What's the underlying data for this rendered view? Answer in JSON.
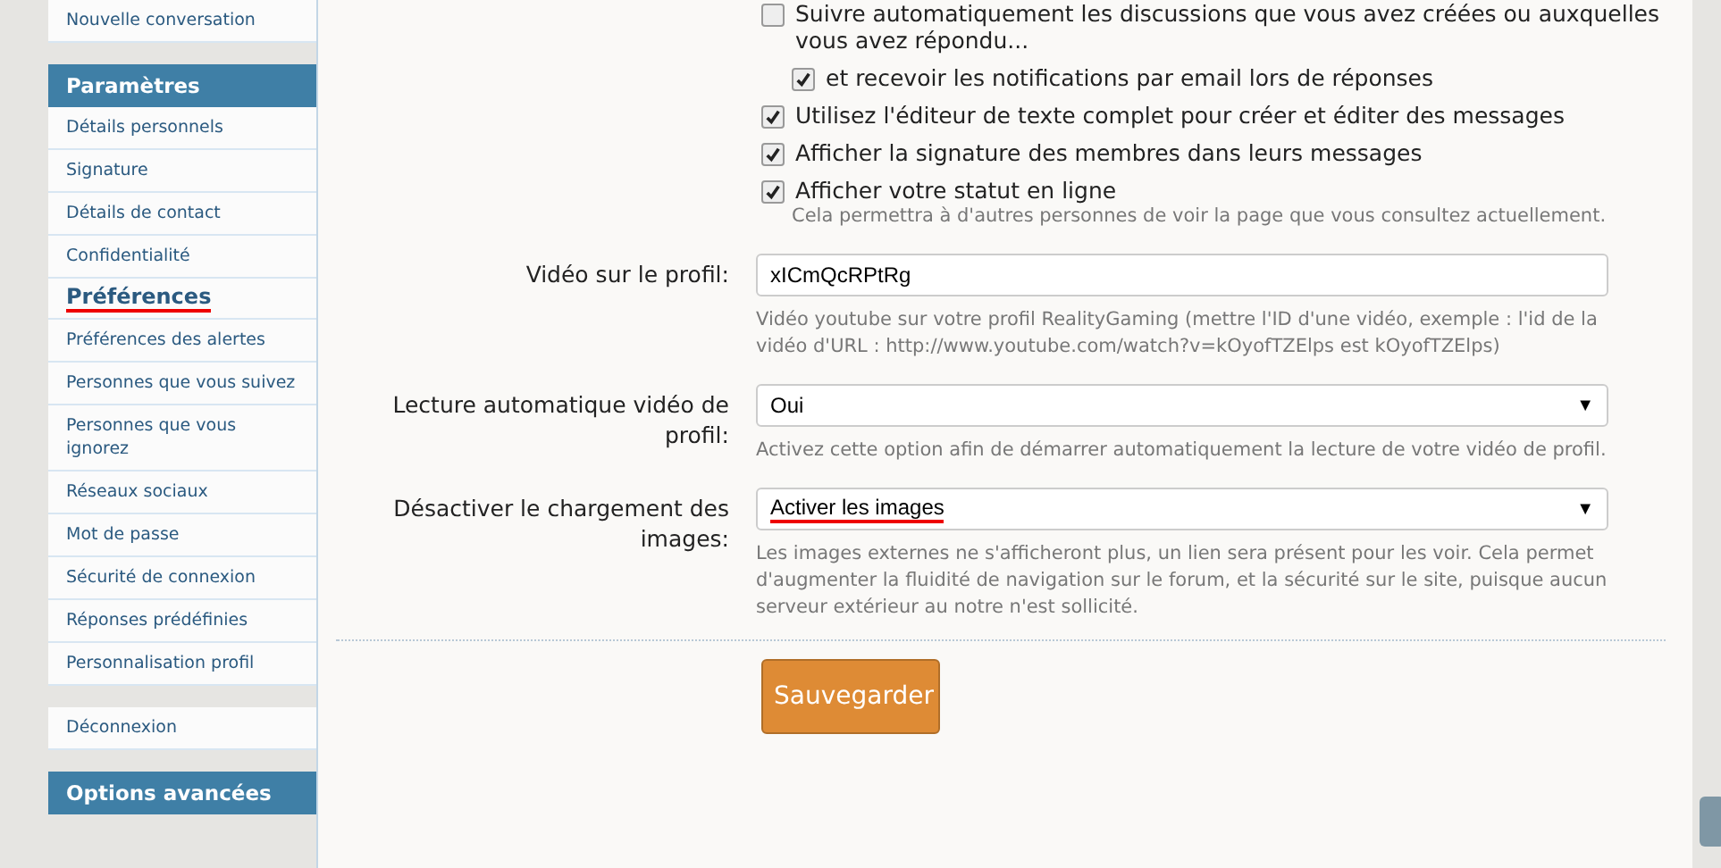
{
  "sidebar": {
    "blocks": [
      {
        "items": [
          {
            "label": "Nouvelle conversation",
            "selected": false,
            "underlined": false
          }
        ]
      },
      {
        "heading": "Paramètres",
        "items": [
          {
            "label": "Détails personnels",
            "selected": false,
            "underlined": false
          },
          {
            "label": "Signature",
            "selected": false,
            "underlined": false
          },
          {
            "label": "Détails de contact",
            "selected": false,
            "underlined": false
          },
          {
            "label": "Confidentialité",
            "selected": false,
            "underlined": false
          },
          {
            "label": "Préférences",
            "selected": true,
            "underlined": true
          },
          {
            "label": "Préférences des alertes",
            "selected": false,
            "underlined": false
          },
          {
            "label": "Personnes que vous suivez",
            "selected": false,
            "underlined": false
          },
          {
            "label": "Personnes que vous ignorez",
            "selected": false,
            "underlined": false
          },
          {
            "label": "Réseaux sociaux",
            "selected": false,
            "underlined": false
          },
          {
            "label": "Mot de passe",
            "selected": false,
            "underlined": false
          },
          {
            "label": "Sécurité de connexion",
            "selected": false,
            "underlined": false
          },
          {
            "label": "Réponses prédéfinies",
            "selected": false,
            "underlined": false
          },
          {
            "label": "Personnalisation profil",
            "selected": false,
            "underlined": false
          }
        ]
      },
      {
        "items": [
          {
            "label": "Déconnexion",
            "selected": false,
            "underlined": false
          }
        ]
      },
      {
        "heading": "Options avancées"
      }
    ]
  },
  "checkboxes": [
    {
      "label": "Suivre automatiquement les discussions que vous avez créées ou auxquelles vous avez répondu...",
      "checked": false,
      "children": [
        {
          "label": "et recevoir les notifications par email lors de réponses",
          "checked": true
        }
      ]
    },
    {
      "label": "Utilisez l'éditeur de texte complet pour créer et éditer des messages",
      "checked": true
    },
    {
      "label": "Afficher la signature des membres dans leurs messages",
      "checked": true
    },
    {
      "label": "Afficher votre statut en ligne",
      "checked": true,
      "hint": "Cela permettra à d'autres personnes de voir la page que vous consultez actuellement."
    }
  ],
  "fields": [
    {
      "kind": "text",
      "label": "Vidéo sur le profil:",
      "value": "xICmQcRPtRg",
      "underlined": false,
      "hint": "Vidéo youtube sur votre profil RealityGaming (mettre l'ID d'une vidéo, exemple : l'id de la vidéo d'URL : http://www.youtube.com/watch?v=kOyofTZElps est kOyofTZElps)"
    },
    {
      "kind": "select",
      "label": "Lecture automatique vidéo de profil:",
      "value": "Oui",
      "arrow": "▼",
      "underlined": false,
      "hint": "Activez cette option afin de démarrer automatiquement la lecture de votre vidéo de profil."
    },
    {
      "kind": "select",
      "label": "Désactiver le chargement des images:",
      "value": "Activer les images",
      "arrow": "▼",
      "underlined": true,
      "hint": "Les images externes ne s'afficheront plus, un lien sera présent pour les voir. Cela permet d'augmenter la fluidité de navigation sur le forum, et la sécurité sur le site, puisque aucun serveur extérieur au notre n'est sollicité."
    }
  ],
  "save_button": {
    "label": "Sauvegarder"
  }
}
